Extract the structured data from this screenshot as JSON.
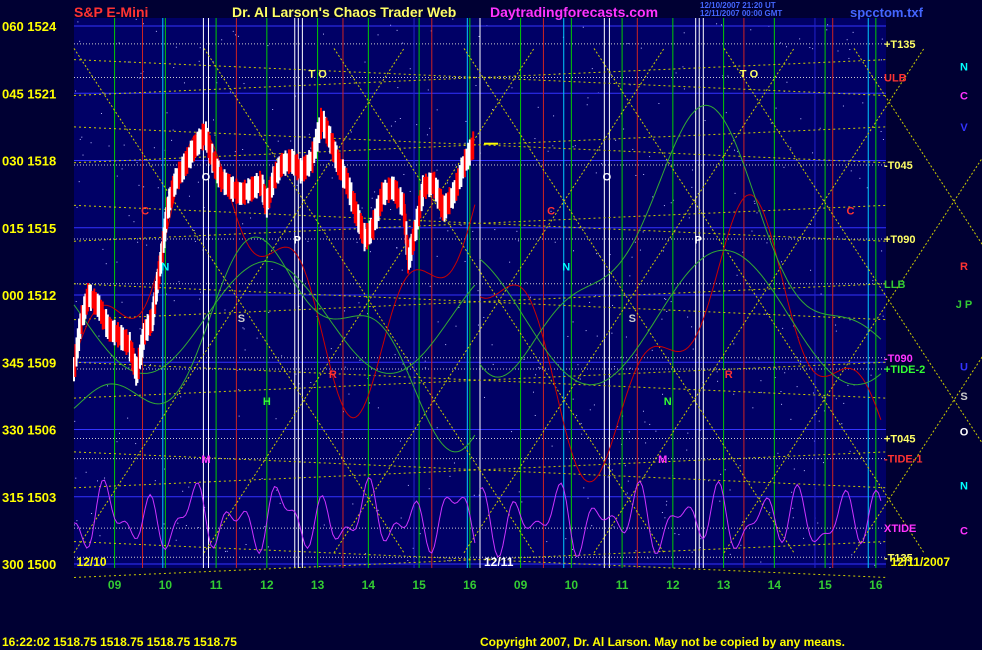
{
  "colors": {
    "background": "#000033",
    "plot_background": "#000066",
    "header_red": "#ff3333",
    "header_yellow": "#ffff66",
    "header_magenta": "#ff33ff",
    "header_blue": "#4466ff",
    "axis_yellow": "#ffff00",
    "hour_green": "#33cc33",
    "grid_green": "#00cc00",
    "grid_blue": "#3333ff",
    "vline_red": "#cc2222",
    "vline_blue": "#2222cc",
    "vline_cyan": "#00ccff",
    "vline_white": "#ffffff",
    "tide_magenta": "#cc33ff",
    "flux_red": "#cc0000",
    "flux_green": "#33aa33",
    "down_bar": "#ff0000",
    "up_bar": "#ffffff",
    "net_yellow": "#cccc00"
  },
  "header": {
    "title_left": "S&P E-Mini",
    "title_center": "Dr. Al Larson's Chaos Trader Web",
    "site": "Daytradingforecasts.com",
    "timestamp_line1": "12/10/2007 21:20 UT",
    "timestamp_line2": "12/11/2007 00:00 GMT",
    "file": "spcctom.txf"
  },
  "footer": {
    "quote": "16:22:02  1518.75  1518.75  1518.75  1518.75",
    "copyright": "Copyright 2007, Dr. Al Larson. May not be copied by any means."
  },
  "chart_data": {
    "type": "line",
    "title": "S&P E-Mini",
    "ylim": [
      1500,
      1524
    ],
    "y_ticks": [
      {
        "label": "300  1500",
        "value": 1500
      },
      {
        "label": "315  1503",
        "value": 1503
      },
      {
        "label": "330  1506",
        "value": 1506
      },
      {
        "label": "345  1509",
        "value": 1509
      },
      {
        "label": "000  1512",
        "value": 1512
      },
      {
        "label": "015  1515",
        "value": 1515
      },
      {
        "label": "030  1518",
        "value": 1518
      },
      {
        "label": "045  1521",
        "value": 1521
      },
      {
        "label": "060  1524",
        "value": 1524
      }
    ],
    "x_ticks": [
      "09",
      "10",
      "11",
      "12",
      "13",
      "14",
      "15",
      "16",
      "09",
      "10",
      "11",
      "12",
      "13",
      "14",
      "15",
      "16"
    ],
    "x_range_hours": [
      8.2,
      16.2
    ],
    "day_labels": [
      "12/10",
      "12/11",
      "12/11/2007"
    ],
    "last_price": 1518.75,
    "right_labels": [
      {
        "text": "+T135",
        "y": 1523.2,
        "color": "#ffff66"
      },
      {
        "text": "ULB",
        "y": 1521.7,
        "color": "#ff3333"
      },
      {
        "text": "-T045",
        "y": 1517.8,
        "color": "#ffff66"
      },
      {
        "text": "+T090",
        "y": 1514.5,
        "color": "#ffff66"
      },
      {
        "text": "LLB",
        "y": 1512.5,
        "color": "#33cc33"
      },
      {
        "text": "-T090",
        "y": 1509.2,
        "color": "#ff33ff"
      },
      {
        "text": "+TIDE-2",
        "y": 1508.7,
        "color": "#33ff33"
      },
      {
        "text": "+T045",
        "y": 1505.6,
        "color": "#ffff66"
      },
      {
        "text": "-TIDE-1",
        "y": 1504.7,
        "color": "#ff3333"
      },
      {
        "text": "XTIDE",
        "y": 1501.6,
        "color": "#ff33ff"
      },
      {
        "text": "-T135",
        "y": 1500.3,
        "color": "#ffff66"
      }
    ],
    "planet_labels_day1": [
      {
        "text": "T O",
        "x": 13.0,
        "y": 1521.7,
        "color": "#ffff66"
      },
      {
        "text": "O",
        "x": 10.8,
        "y": 1517.1,
        "color": "#ffffff"
      },
      {
        "text": "C",
        "x": 9.6,
        "y": 1515.6,
        "color": "#ff3333"
      },
      {
        "text": "P",
        "x": 12.6,
        "y": 1514.3,
        "color": "#ffffff"
      },
      {
        "text": "N",
        "x": 10.0,
        "y": 1513.1,
        "color": "#00ffff"
      },
      {
        "text": "S",
        "x": 11.5,
        "y": 1510.8,
        "color": "#cccccc"
      },
      {
        "text": "R",
        "x": 13.3,
        "y": 1508.3,
        "color": "#ff3333"
      },
      {
        "text": "H",
        "x": 12.0,
        "y": 1507.1,
        "color": "#33ff33"
      },
      {
        "text": "M",
        "x": 10.8,
        "y": 1504.5,
        "color": "#ff33ff"
      }
    ],
    "planet_labels_day2": [
      {
        "text": "T O",
        "x": 13.5,
        "y": 1521.7,
        "color": "#ffff66"
      },
      {
        "text": "O",
        "x": 10.7,
        "y": 1517.1,
        "color": "#ffffff"
      },
      {
        "text": "C",
        "x": 9.6,
        "y": 1515.6,
        "color": "#ff3333"
      },
      {
        "text": "P",
        "x": 12.5,
        "y": 1514.3,
        "color": "#ffffff"
      },
      {
        "text": "N",
        "x": 9.9,
        "y": 1513.1,
        "color": "#00ffff"
      },
      {
        "text": "S",
        "x": 11.2,
        "y": 1510.8,
        "color": "#cccccc"
      },
      {
        "text": "R",
        "x": 13.1,
        "y": 1508.3,
        "color": "#ff3333"
      },
      {
        "text": "N",
        "x": 11.9,
        "y": 1507.1,
        "color": "#33ff33"
      },
      {
        "text": "M",
        "x": 11.8,
        "y": 1504.5,
        "color": "#ff33ff"
      },
      {
        "text": "C",
        "x": 15.5,
        "y": 1515.6,
        "color": "#ff3333"
      }
    ],
    "side_planets": [
      {
        "text": "N",
        "y": 1522.2,
        "color": "#00ffff"
      },
      {
        "text": "C",
        "y": 1520.9,
        "color": "#ff33ff"
      },
      {
        "text": "V",
        "y": 1519.5,
        "color": "#3333ff"
      },
      {
        "text": "R",
        "y": 1513.3,
        "color": "#ff3333"
      },
      {
        "text": "J  P",
        "y": 1511.6,
        "color": "#33cc33"
      },
      {
        "text": "U",
        "y": 1508.8,
        "color": "#3333ff"
      },
      {
        "text": "S",
        "y": 1507.5,
        "color": "#cccccc"
      },
      {
        "text": "O",
        "y": 1505.9,
        "color": "#ffffff"
      },
      {
        "text": "N",
        "y": 1503.5,
        "color": "#00ffff"
      },
      {
        "text": "C",
        "y": 1501.5,
        "color": "#ff33ff"
      }
    ],
    "price": [
      [
        8.2,
        1508.5
      ],
      [
        8.35,
        1510.8
      ],
      [
        8.5,
        1512.0
      ],
      [
        8.7,
        1511.5
      ],
      [
        8.9,
        1510.5
      ],
      [
        9.1,
        1510.2
      ],
      [
        9.3,
        1509.8
      ],
      [
        9.45,
        1508.5
      ],
      [
        9.6,
        1510.3
      ],
      [
        9.75,
        1510.9
      ],
      [
        9.85,
        1512.5
      ],
      [
        9.95,
        1514.0
      ],
      [
        10.05,
        1515.8
      ],
      [
        10.2,
        1517.0
      ],
      [
        10.4,
        1517.8
      ],
      [
        10.6,
        1518.6
      ],
      [
        10.8,
        1519.2
      ],
      [
        10.95,
        1518.0
      ],
      [
        11.1,
        1517.2
      ],
      [
        11.3,
        1516.8
      ],
      [
        11.5,
        1516.5
      ],
      [
        11.7,
        1516.7
      ],
      [
        11.9,
        1517.0
      ],
      [
        12.0,
        1516.0
      ],
      [
        12.15,
        1517.2
      ],
      [
        12.3,
        1517.8
      ],
      [
        12.5,
        1518.0
      ],
      [
        12.7,
        1517.5
      ],
      [
        12.9,
        1518.0
      ],
      [
        13.1,
        1519.8
      ],
      [
        13.25,
        1519.0
      ],
      [
        13.4,
        1518.0
      ],
      [
        13.6,
        1517.0
      ],
      [
        13.8,
        1515.5
      ],
      [
        13.95,
        1514.5
      ],
      [
        14.1,
        1515.0
      ],
      [
        14.3,
        1516.5
      ],
      [
        14.5,
        1516.8
      ],
      [
        14.7,
        1516.0
      ],
      [
        14.8,
        1513.5
      ],
      [
        14.95,
        1515.0
      ],
      [
        15.1,
        1516.8
      ],
      [
        15.3,
        1517.0
      ],
      [
        15.5,
        1515.8
      ],
      [
        15.7,
        1516.5
      ],
      [
        15.9,
        1517.8
      ],
      [
        16.1,
        1518.75
      ]
    ]
  }
}
